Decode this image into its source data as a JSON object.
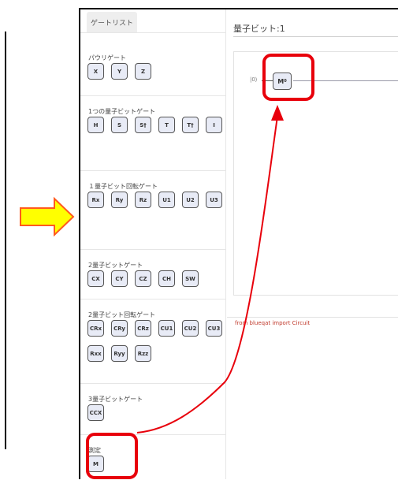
{
  "panel": {
    "tab_label": "ゲートリスト",
    "sections": [
      {
        "title": "パウリゲート",
        "gates": [
          "X",
          "Y",
          "Z"
        ]
      },
      {
        "title": "1つの量子ビットゲート",
        "gates": [
          "H",
          "S",
          "S†",
          "T",
          "T†",
          "I"
        ]
      },
      {
        "title": "１量子ビット回転ゲート",
        "gates": [
          "Rx",
          "Ry",
          "Rz",
          "U1",
          "U2",
          "U3"
        ]
      },
      {
        "title": "2量子ビットゲート",
        "gates": [
          "CX",
          "CY",
          "CZ",
          "CH",
          "SW"
        ]
      },
      {
        "title": "2量子ビット回転ゲート",
        "gates": [
          "CRx",
          "CRy",
          "CRz",
          "CU1",
          "CU2",
          "CU3",
          "Rxx",
          "Ryy",
          "Rzz"
        ]
      },
      {
        "title": "3量子ビットゲート",
        "gates": [
          "CCX"
        ]
      },
      {
        "title": "測定",
        "gates": [
          "M"
        ]
      }
    ]
  },
  "canvas": {
    "qubit_label": "量子ビット:1",
    "ket_label": "|0⟩",
    "placed_gate": "M",
    "placed_gate_sub": "0",
    "code_text": "from blueqat import Circuit"
  },
  "colors": {
    "highlight": "#e8000b",
    "arrow_fill": "#ffff00",
    "arrow_stroke": "#ff5a1e",
    "gate_bg": "#e8ebf6"
  }
}
